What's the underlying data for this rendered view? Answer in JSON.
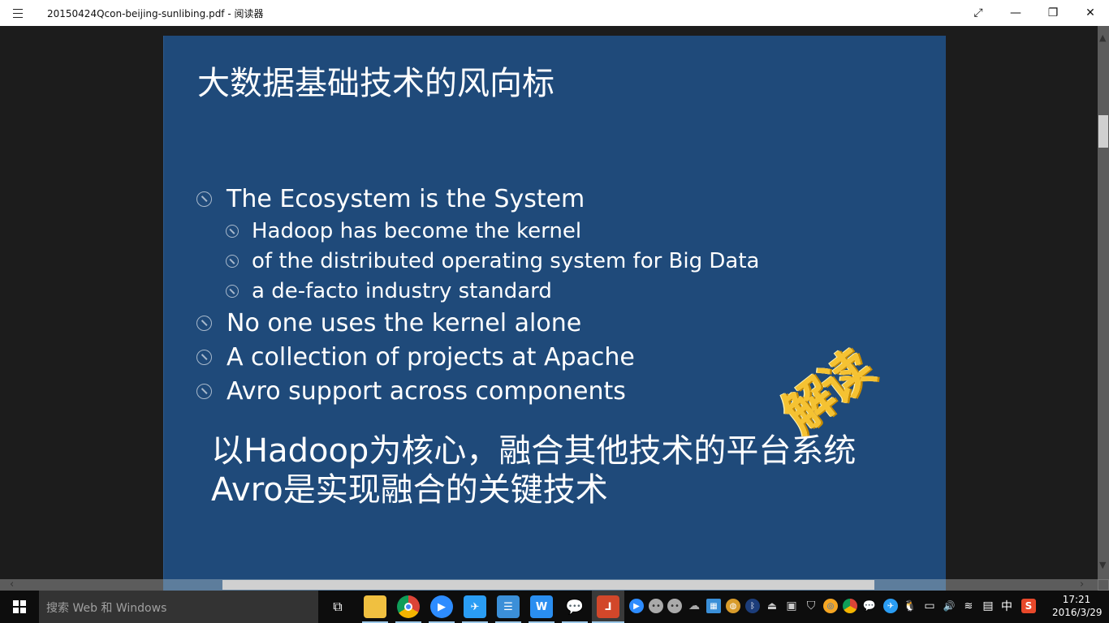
{
  "window": {
    "title": "20150424Qcon-beijing-sunlibing.pdf - 阅读器",
    "controls": {
      "fullscreen": "⤢",
      "minimize": "—",
      "restore": "❐",
      "close": "✕"
    }
  },
  "slide": {
    "title": "大数据基础技术的风向标",
    "bullets": [
      {
        "level": 1,
        "text": "The Ecosystem is the System"
      },
      {
        "level": 2,
        "text": "Hadoop has become the kernel"
      },
      {
        "level": 2,
        "text": "of the distributed operating system for Big Data"
      },
      {
        "level": 2,
        "text": "a de-facto industry standard"
      },
      {
        "level": 1,
        "text": "No one uses the kernel alone"
      },
      {
        "level": 1,
        "text": "A collection of projects at Apache"
      },
      {
        "level": 1,
        "text": "Avro support across components"
      }
    ],
    "summary_lines": [
      "以Hadoop为核心，融合其他技术的平台系统",
      "Avro是实现融合的关键技术"
    ],
    "stamp": "解读",
    "colors": {
      "background": "#1f4a7a",
      "stamp": "#f5c232"
    }
  },
  "zoom_controls": {
    "zoom_out": "−",
    "zoom_in": "+"
  },
  "scrollbars": {
    "up": "▲",
    "down": "▼",
    "left": "‹",
    "right": "›"
  },
  "taskbar": {
    "search_placeholder": "搜索 Web 和 Windows",
    "pinned": [
      {
        "name": "task-view",
        "glyph": "⧉"
      },
      {
        "name": "file-explorer",
        "glyph": "📁"
      },
      {
        "name": "chrome",
        "glyph": "◉"
      },
      {
        "name": "zoom",
        "glyph": "▶"
      },
      {
        "name": "dingtalk",
        "glyph": "✈"
      },
      {
        "name": "messages",
        "glyph": "☰"
      },
      {
        "name": "wps-writer",
        "glyph": "W"
      },
      {
        "name": "wechat",
        "glyph": "💬"
      },
      {
        "name": "reader",
        "glyph": "⅃"
      }
    ],
    "tray": [
      {
        "name": "zoom-tray",
        "glyph": "▶"
      },
      {
        "name": "chat-tray-1",
        "glyph": "••"
      },
      {
        "name": "chat-tray-2",
        "glyph": "••"
      },
      {
        "name": "cloud-tray",
        "glyph": "☁"
      },
      {
        "name": "network-app-tray",
        "glyph": "▦"
      },
      {
        "name": "globe-tray",
        "glyph": "◍"
      },
      {
        "name": "bluetooth-tray",
        "glyph": "ᛒ"
      },
      {
        "name": "usb-tray",
        "glyph": "⏏"
      },
      {
        "name": "display-tray",
        "glyph": "▣"
      },
      {
        "name": "security-tray",
        "glyph": "⛉"
      },
      {
        "name": "update-tray",
        "glyph": "◎"
      },
      {
        "name": "chrome-tray",
        "glyph": "◉"
      },
      {
        "name": "wechat-tray",
        "glyph": "💬"
      },
      {
        "name": "dingtalk-tray",
        "glyph": "✈"
      },
      {
        "name": "qq-tray",
        "glyph": "🐧"
      },
      {
        "name": "battery-tray",
        "glyph": "▭"
      },
      {
        "name": "volume-tray",
        "glyph": "🔊"
      },
      {
        "name": "wifi-tray",
        "glyph": "≋"
      },
      {
        "name": "action-center-tray",
        "glyph": "▤"
      },
      {
        "name": "ime-tray",
        "glyph": "中"
      },
      {
        "name": "sogou-tray",
        "glyph": "S"
      }
    ],
    "time": "17:21",
    "date": "2016/3/29"
  }
}
